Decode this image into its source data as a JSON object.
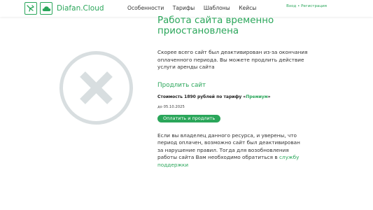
{
  "header": {
    "brand": "Diafan.Cloud",
    "nav": [
      "Особенности",
      "Тарифы",
      "Шаблоны",
      "Кейсы"
    ],
    "login": "Вход",
    "separator": " • ",
    "register": "Регистрация"
  },
  "main": {
    "title": "Работа сайта временно приостановлена",
    "description": "Скорее всего сайт был деактивирован из-за окончания оплаченного периода. Вы можете продлить действие услуги аренды сайта",
    "extend_heading": "Продлить сайт",
    "price_prefix": "Стоимость 1890 рублей по тарифу «",
    "tariff": "Премиум",
    "price_suffix": "»",
    "until": "до 05.10.2025",
    "pay_button": "Оплатить и продлить",
    "note": "Если вы владелец данного ресурса, и уверены, что период оплачен, возможно сайт был деактивирован за нарушение правил. Тогда для возобновления работы сайта Вам необходимо обратиться в ",
    "support_link": "службу поддержки"
  },
  "colors": {
    "accent": "#2aa65a",
    "error_icon": "#d8dee0"
  },
  "icons": {
    "logo": "bird-logo-icon",
    "cloud": "cloud-icon",
    "error": "circle-x-icon"
  }
}
